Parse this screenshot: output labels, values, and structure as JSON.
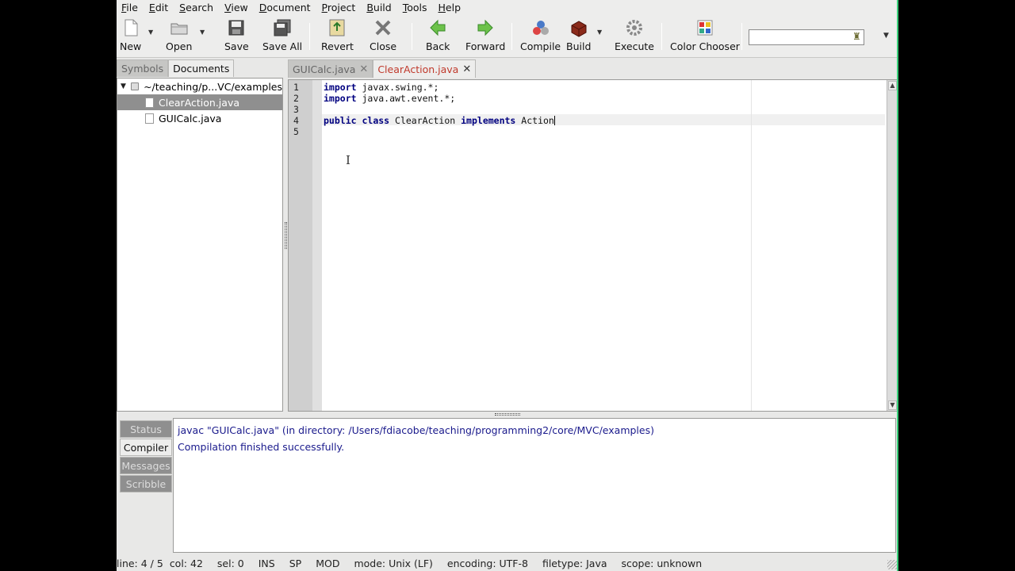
{
  "menubar": [
    "File",
    "Edit",
    "Search",
    "View",
    "Document",
    "Project",
    "Build",
    "Tools",
    "Help"
  ],
  "toolbar": {
    "new": "New",
    "open": "Open",
    "save": "Save",
    "save_all": "Save All",
    "revert": "Revert",
    "close": "Close",
    "back": "Back",
    "forward": "Forward",
    "compile": "Compile",
    "build": "Build",
    "execute": "Execute",
    "color_chooser": "Color Chooser",
    "search_value": ""
  },
  "sidebar": {
    "tabs": [
      "Symbols",
      "Documents"
    ],
    "active_tab": "Documents",
    "folder": "~/teaching/p...VC/examples",
    "files": [
      "ClearAction.java",
      "GUICalc.java"
    ],
    "selected": "ClearAction.java"
  },
  "editor": {
    "tabs": [
      "GUICalc.java",
      "ClearAction.java"
    ],
    "active_tab": "ClearAction.java",
    "line_numbers": [
      "1",
      "2",
      "3",
      "4",
      "5"
    ],
    "lines": {
      "l1_kw": "import",
      "l1_rest": " javax.swing.*;",
      "l2_kw": "import",
      "l2_rest": " java.awt.event.*;",
      "l4_kw1": "public",
      "l4_kw2": "class",
      "l4_name": " ClearAction ",
      "l4_kw3": "implements",
      "l4_rest": " Action"
    }
  },
  "messages": {
    "tabs": [
      "Status",
      "Compiler",
      "Messages",
      "Scribble"
    ],
    "active_tab": "Compiler",
    "lines": [
      "javac \"GUICalc.java\" (in directory: /Users/fdiacobe/teaching/programming2/core/MVC/examples)",
      "Compilation finished successfully."
    ]
  },
  "statusbar": {
    "line": "line: 4 / 5",
    "col": "col: 42",
    "sel": "sel: 0",
    "ins": "INS",
    "sp": "SP",
    "mod": "MOD",
    "mode": "mode: Unix (LF)",
    "encoding": "encoding: UTF-8",
    "filetype": "filetype: Java",
    "scope": "scope: unknown"
  },
  "colors": {
    "accent_window_border": "#3ad07a",
    "active_tab_text": "#c0392b",
    "message_text": "#1a1a8c"
  }
}
